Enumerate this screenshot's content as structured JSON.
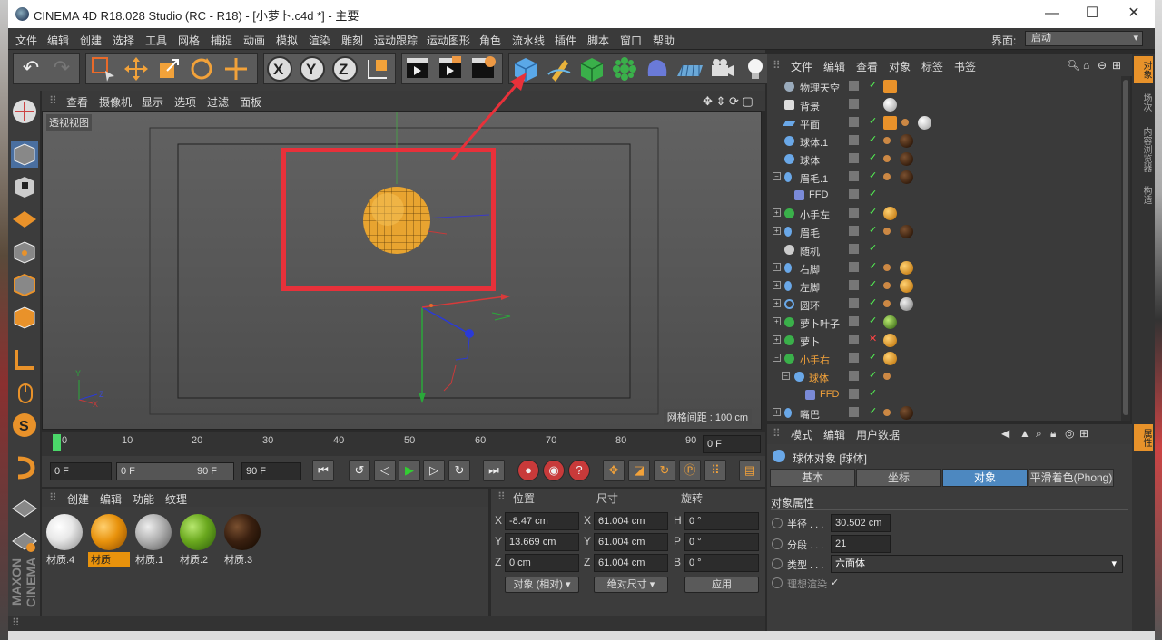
{
  "window": {
    "title": "CINEMA 4D R18.028 Studio (RC - R18) - [小萝卜.c4d *] - 主要",
    "min": "—",
    "max": "☐",
    "close": "✕"
  },
  "menu": [
    "文件",
    "编辑",
    "创建",
    "选择",
    "工具",
    "网格",
    "捕捉",
    "动画",
    "模拟",
    "渲染",
    "雕刻",
    "运动跟踪",
    "运动图形",
    "角色",
    "流水线",
    "插件",
    "脚本",
    "窗口",
    "帮助"
  ],
  "layout": {
    "label": "界面:",
    "value": "启动"
  },
  "viewport": {
    "menu": [
      "查看",
      "摄像机",
      "显示",
      "选项",
      "过滤",
      "面板"
    ],
    "name": "透视视图",
    "grid_distance": "网格间距 : 100 cm"
  },
  "timeline": {
    "ticks": [
      "0",
      "10",
      "20",
      "30",
      "40",
      "50",
      "60",
      "70",
      "80",
      "90"
    ],
    "current_frame": "0 F",
    "start": "0 F",
    "range_start": "0 F",
    "range_end": "90 F",
    "end": "90 F"
  },
  "materials": {
    "menu": [
      "创建",
      "编辑",
      "功能",
      "纹理"
    ],
    "items": [
      {
        "name": "材质.4",
        "color": "#e8e8e8"
      },
      {
        "name": "材质",
        "color": "#e8920c",
        "selected": true
      },
      {
        "name": "材质.1",
        "color": "#b0b0b0"
      },
      {
        "name": "材质.2",
        "color": "#6aa81e"
      },
      {
        "name": "材质.3",
        "color": "#3a2010"
      }
    ]
  },
  "coordinates": {
    "headers": [
      "位置",
      "尺寸",
      "旋转"
    ],
    "rows": [
      {
        "axis": "X",
        "pos": "-8.47 cm",
        "size_axis": "X",
        "size": "61.004 cm",
        "rot_axis": "H",
        "rot": "0 °"
      },
      {
        "axis": "Y",
        "pos": "13.669 cm",
        "size_axis": "Y",
        "size": "61.004 cm",
        "rot_axis": "P",
        "rot": "0 °"
      },
      {
        "axis": "Z",
        "pos": "0 cm",
        "size_axis": "Z",
        "size": "61.004 cm",
        "rot_axis": "B",
        "rot": "0 °"
      }
    ],
    "mode": "对象 (相对)",
    "size_mode": "绝对尺寸",
    "apply": "应用"
  },
  "object_manager": {
    "menu": [
      "文件",
      "编辑",
      "查看",
      "对象",
      "标签",
      "书签"
    ],
    "objects": [
      {
        "name": "物理天空",
        "depth": 0,
        "tree": ""
      },
      {
        "name": "背景",
        "depth": 0,
        "tree": ""
      },
      {
        "name": "平面",
        "depth": 0,
        "tree": ""
      },
      {
        "name": "球体.1",
        "depth": 0,
        "tree": ""
      },
      {
        "name": "球体",
        "depth": 0,
        "tree": ""
      },
      {
        "name": "眉毛.1",
        "depth": 0,
        "tree": "−"
      },
      {
        "name": "FFD",
        "depth": 1,
        "tree": ""
      },
      {
        "name": "小手左",
        "depth": 0,
        "tree": "+"
      },
      {
        "name": "眉毛",
        "depth": 0,
        "tree": "+"
      },
      {
        "name": "随机",
        "depth": 0,
        "tree": ""
      },
      {
        "name": "右脚",
        "depth": 0,
        "tree": "+"
      },
      {
        "name": "左脚",
        "depth": 0,
        "tree": "+"
      },
      {
        "name": "圆环",
        "depth": 0,
        "tree": "+"
      },
      {
        "name": "萝卜叶子",
        "depth": 0,
        "tree": "+"
      },
      {
        "name": "萝卜",
        "depth": 0,
        "tree": "+"
      },
      {
        "name": "小手右",
        "depth": 0,
        "tree": "−",
        "highlight": true
      },
      {
        "name": "球体",
        "depth": 1,
        "tree": "−",
        "highlight": true
      },
      {
        "name": "FFD",
        "depth": 2,
        "tree": "",
        "highlight": true
      },
      {
        "name": "嘴巴",
        "depth": 0,
        "tree": "+"
      }
    ]
  },
  "right_tabs": [
    "对象",
    "场次",
    "内容浏览器",
    "构造"
  ],
  "attributes": {
    "menu": [
      "模式",
      "编辑",
      "用户数据"
    ],
    "title": "球体对象 [球体]",
    "tabs": [
      "基本",
      "坐标",
      "对象",
      "平滑着色(Phong)"
    ],
    "section": "对象属性",
    "fields": [
      {
        "label": "半径 . . .",
        "value": "30.502 cm"
      },
      {
        "label": "分段 . . .",
        "value": "21"
      },
      {
        "label": "类型 . . .",
        "value": "六面体"
      },
      {
        "label": "理想渲染",
        "value": "✓"
      }
    ],
    "side_tab": "属性"
  }
}
